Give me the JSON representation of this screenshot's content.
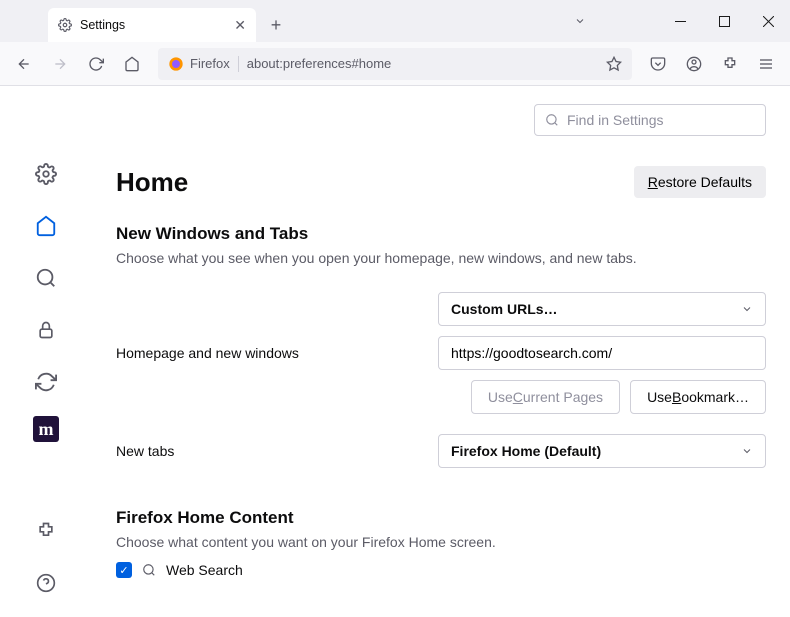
{
  "tab": {
    "title": "Settings"
  },
  "url": {
    "identity": "Firefox",
    "path": "about:preferences#home"
  },
  "search": {
    "placeholder": "Find in Settings"
  },
  "page": {
    "title": "Home",
    "restore": "Restore Defaults",
    "restore_pre": "R",
    "restore_rest": "estore Defaults"
  },
  "nwt": {
    "heading": "New Windows and Tabs",
    "desc": "Choose what you see when you open your homepage, new windows, and new tabs.",
    "hp_label": "Homepage and new windows",
    "hp_select": "Custom URLs…",
    "hp_url": "https://goodtosearch.com/",
    "use_current_pre": "Use ",
    "use_current_u": "C",
    "use_current_post": "urrent Pages",
    "use_bookmark_pre": "Use ",
    "use_bookmark_u": "B",
    "use_bookmark_post": "ookmark…",
    "newtabs_label": "New tabs",
    "newtabs_select": "Firefox Home (Default)"
  },
  "fhc": {
    "heading": "Firefox Home Content",
    "desc": "Choose what content you want on your Firefox Home screen.",
    "websearch": "Web Search"
  }
}
